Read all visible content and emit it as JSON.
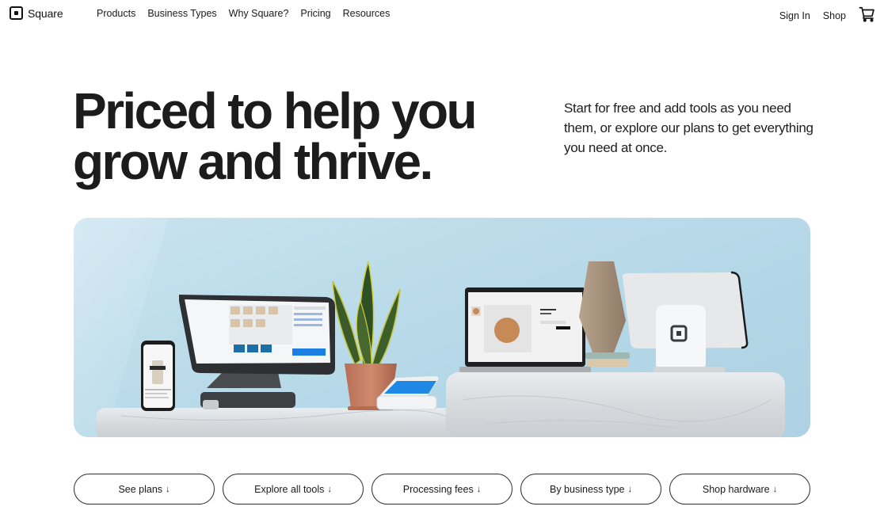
{
  "header": {
    "brand": "Square",
    "nav": [
      "Products",
      "Business Types",
      "Why Square?",
      "Pricing",
      "Resources"
    ],
    "sign_in": "Sign In",
    "shop": "Shop",
    "cart_icon": "shopping-cart-icon"
  },
  "hero": {
    "headline_line1": "Priced to help you",
    "headline_line2": "grow and thrive.",
    "subtext": "Start for free and add tools as you need them, or explore our plans to get everything you need at once.",
    "image_alt": "Square hardware (smartphone, POS register, plant, card reader, laptop, vase, Square stand) on marble counter against light blue wall"
  },
  "pills": [
    {
      "label": "See plans",
      "arrow": "↓"
    },
    {
      "label": "Explore all tools",
      "arrow": "↓"
    },
    {
      "label": "Processing fees",
      "arrow": "↓"
    },
    {
      "label": "By business type",
      "arrow": "↓"
    },
    {
      "label": "Shop hardware",
      "arrow": "↓"
    }
  ]
}
